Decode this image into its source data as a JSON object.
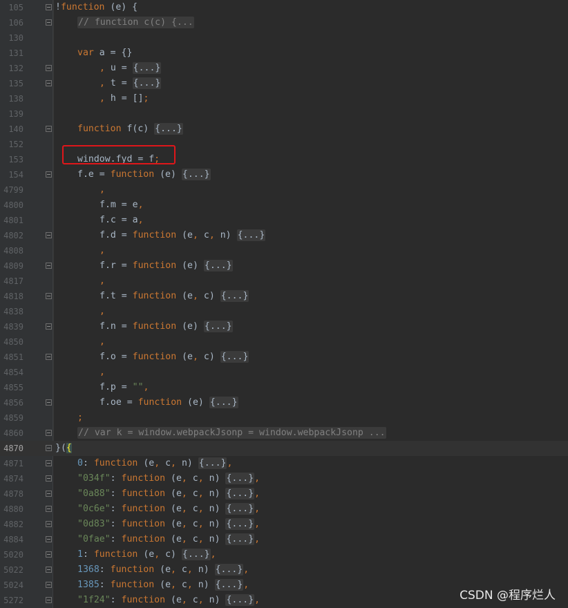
{
  "editor": {
    "current_line": "4870",
    "lines": [
      {
        "n": "105",
        "indent": 0,
        "fold": true,
        "tokens": [
          [
            "op",
            "!"
          ],
          [
            "kw",
            "function"
          ],
          [
            "txt",
            " (e) {"
          ]
        ]
      },
      {
        "n": "106",
        "indent": 1,
        "fold": true,
        "tokens": [
          [
            "fcmt",
            "// function c(c) {..."
          ]
        ]
      },
      {
        "n": "130",
        "indent": 0,
        "fold": false,
        "tokens": []
      },
      {
        "n": "131",
        "indent": 1,
        "fold": false,
        "tokens": [
          [
            "kw",
            "var"
          ],
          [
            "txt",
            " a = {}"
          ]
        ]
      },
      {
        "n": "132",
        "indent": 2,
        "fold": true,
        "tokens": [
          [
            "kw",
            ", "
          ],
          [
            "txt",
            "u = "
          ],
          [
            "fold",
            "{...}"
          ]
        ]
      },
      {
        "n": "135",
        "indent": 2,
        "fold": true,
        "tokens": [
          [
            "kw",
            ", "
          ],
          [
            "txt",
            "t = "
          ],
          [
            "fold",
            "{...}"
          ]
        ]
      },
      {
        "n": "138",
        "indent": 2,
        "fold": false,
        "tokens": [
          [
            "kw",
            ", "
          ],
          [
            "txt",
            "h = []"
          ],
          [
            "kw",
            ";"
          ]
        ]
      },
      {
        "n": "139",
        "indent": 0,
        "fold": false,
        "tokens": []
      },
      {
        "n": "140",
        "indent": 1,
        "fold": true,
        "tokens": [
          [
            "kw",
            "function"
          ],
          [
            "txt",
            " f(c) "
          ],
          [
            "fold",
            "{...}"
          ]
        ]
      },
      {
        "n": "152",
        "indent": 0,
        "fold": false,
        "tokens": []
      },
      {
        "n": "153",
        "indent": 1,
        "fold": false,
        "tokens": [
          [
            "txt",
            "window.fyd = f"
          ],
          [
            "kw",
            ";"
          ]
        ]
      },
      {
        "n": "154",
        "indent": 1,
        "fold": true,
        "tokens": [
          [
            "txt",
            "f.e = "
          ],
          [
            "kw",
            "function"
          ],
          [
            "txt",
            " (e) "
          ],
          [
            "fold",
            "{...}"
          ]
        ]
      },
      {
        "n": "4799",
        "indent": 2,
        "fold": false,
        "tokens": [
          [
            "kw",
            ","
          ]
        ]
      },
      {
        "n": "4800",
        "indent": 2,
        "fold": false,
        "tokens": [
          [
            "txt",
            "f.m = e"
          ],
          [
            "kw",
            ","
          ]
        ]
      },
      {
        "n": "4801",
        "indent": 2,
        "fold": false,
        "tokens": [
          [
            "txt",
            "f.c = a"
          ],
          [
            "kw",
            ","
          ]
        ]
      },
      {
        "n": "4802",
        "indent": 2,
        "fold": true,
        "tokens": [
          [
            "txt",
            "f.d = "
          ],
          [
            "kw",
            "function"
          ],
          [
            "txt",
            " (e"
          ],
          [
            "kw",
            ","
          ],
          [
            "txt",
            " c"
          ],
          [
            "kw",
            ","
          ],
          [
            "txt",
            " n) "
          ],
          [
            "fold",
            "{...}"
          ]
        ]
      },
      {
        "n": "4808",
        "indent": 2,
        "fold": false,
        "tokens": [
          [
            "kw",
            ","
          ]
        ]
      },
      {
        "n": "4809",
        "indent": 2,
        "fold": true,
        "tokens": [
          [
            "txt",
            "f.r = "
          ],
          [
            "kw",
            "function"
          ],
          [
            "txt",
            " (e) "
          ],
          [
            "fold",
            "{...}"
          ]
        ]
      },
      {
        "n": "4817",
        "indent": 2,
        "fold": false,
        "tokens": [
          [
            "kw",
            ","
          ]
        ]
      },
      {
        "n": "4818",
        "indent": 2,
        "fold": true,
        "tokens": [
          [
            "txt",
            "f.t = "
          ],
          [
            "kw",
            "function"
          ],
          [
            "txt",
            " (e"
          ],
          [
            "kw",
            ","
          ],
          [
            "txt",
            " c) "
          ],
          [
            "fold",
            "{...}"
          ]
        ]
      },
      {
        "n": "4838",
        "indent": 2,
        "fold": false,
        "tokens": [
          [
            "kw",
            ","
          ]
        ]
      },
      {
        "n": "4839",
        "indent": 2,
        "fold": true,
        "tokens": [
          [
            "txt",
            "f.n = "
          ],
          [
            "kw",
            "function"
          ],
          [
            "txt",
            " (e) "
          ],
          [
            "fold",
            "{...}"
          ]
        ]
      },
      {
        "n": "4850",
        "indent": 2,
        "fold": false,
        "tokens": [
          [
            "kw",
            ","
          ]
        ]
      },
      {
        "n": "4851",
        "indent": 2,
        "fold": true,
        "tokens": [
          [
            "txt",
            "f.o = "
          ],
          [
            "kw",
            "function"
          ],
          [
            "txt",
            " (e"
          ],
          [
            "kw",
            ","
          ],
          [
            "txt",
            " c) "
          ],
          [
            "fold",
            "{...}"
          ]
        ]
      },
      {
        "n": "4854",
        "indent": 2,
        "fold": false,
        "tokens": [
          [
            "kw",
            ","
          ]
        ]
      },
      {
        "n": "4855",
        "indent": 2,
        "fold": false,
        "tokens": [
          [
            "txt",
            "f.p = "
          ],
          [
            "str",
            "\"\""
          ],
          [
            "kw",
            ","
          ]
        ]
      },
      {
        "n": "4856",
        "indent": 2,
        "fold": true,
        "tokens": [
          [
            "txt",
            "f.oe = "
          ],
          [
            "kw",
            "function"
          ],
          [
            "txt",
            " (e) "
          ],
          [
            "fold",
            "{...}"
          ]
        ]
      },
      {
        "n": "4859",
        "indent": 1,
        "fold": false,
        "tokens": [
          [
            "kw",
            ";"
          ]
        ]
      },
      {
        "n": "4860",
        "indent": 1,
        "fold": true,
        "tokens": [
          [
            "fcmt",
            "// var k = window.webpackJsonp = window.webpackJsonp ..."
          ]
        ]
      },
      {
        "n": "4870",
        "indent": 0,
        "fold": true,
        "tokens": [
          [
            "txt",
            "}("
          ],
          [
            "hl",
            "{"
          ]
        ]
      },
      {
        "n": "4871",
        "indent": 1,
        "fold": true,
        "tokens": [
          [
            "num",
            "0"
          ],
          [
            "txt",
            ": "
          ],
          [
            "kw",
            "function"
          ],
          [
            "txt",
            " (e"
          ],
          [
            "kw",
            ","
          ],
          [
            "txt",
            " c"
          ],
          [
            "kw",
            ","
          ],
          [
            "txt",
            " n) "
          ],
          [
            "fold",
            "{...}"
          ],
          [
            "kw",
            ","
          ]
        ]
      },
      {
        "n": "4874",
        "indent": 1,
        "fold": true,
        "tokens": [
          [
            "str",
            "\"034f\""
          ],
          [
            "txt",
            ": "
          ],
          [
            "kw",
            "function"
          ],
          [
            "txt",
            " (e"
          ],
          [
            "kw",
            ","
          ],
          [
            "txt",
            " c"
          ],
          [
            "kw",
            ","
          ],
          [
            "txt",
            " n) "
          ],
          [
            "fold",
            "{...}"
          ],
          [
            "kw",
            ","
          ]
        ]
      },
      {
        "n": "4878",
        "indent": 1,
        "fold": true,
        "tokens": [
          [
            "str",
            "\"0a88\""
          ],
          [
            "txt",
            ": "
          ],
          [
            "kw",
            "function"
          ],
          [
            "txt",
            " (e"
          ],
          [
            "kw",
            ","
          ],
          [
            "txt",
            " c"
          ],
          [
            "kw",
            ","
          ],
          [
            "txt",
            " n) "
          ],
          [
            "fold",
            "{...}"
          ],
          [
            "kw",
            ","
          ]
        ]
      },
      {
        "n": "4880",
        "indent": 1,
        "fold": true,
        "tokens": [
          [
            "str",
            "\"0c6e\""
          ],
          [
            "txt",
            ": "
          ],
          [
            "kw",
            "function"
          ],
          [
            "txt",
            " (e"
          ],
          [
            "kw",
            ","
          ],
          [
            "txt",
            " c"
          ],
          [
            "kw",
            ","
          ],
          [
            "txt",
            " n) "
          ],
          [
            "fold",
            "{...}"
          ],
          [
            "kw",
            ","
          ]
        ]
      },
      {
        "n": "4882",
        "indent": 1,
        "fold": true,
        "tokens": [
          [
            "str",
            "\"0d83\""
          ],
          [
            "txt",
            ": "
          ],
          [
            "kw",
            "function"
          ],
          [
            "txt",
            " (e"
          ],
          [
            "kw",
            ","
          ],
          [
            "txt",
            " c"
          ],
          [
            "kw",
            ","
          ],
          [
            "txt",
            " n) "
          ],
          [
            "fold",
            "{...}"
          ],
          [
            "kw",
            ","
          ]
        ]
      },
      {
        "n": "4884",
        "indent": 1,
        "fold": true,
        "tokens": [
          [
            "str",
            "\"0fae\""
          ],
          [
            "txt",
            ": "
          ],
          [
            "kw",
            "function"
          ],
          [
            "txt",
            " (e"
          ],
          [
            "kw",
            ","
          ],
          [
            "txt",
            " c"
          ],
          [
            "kw",
            ","
          ],
          [
            "txt",
            " n) "
          ],
          [
            "fold",
            "{...}"
          ],
          [
            "kw",
            ","
          ]
        ]
      },
      {
        "n": "5020",
        "indent": 1,
        "fold": true,
        "tokens": [
          [
            "num",
            "1"
          ],
          [
            "txt",
            ": "
          ],
          [
            "kw",
            "function"
          ],
          [
            "txt",
            " (e"
          ],
          [
            "kw",
            ","
          ],
          [
            "txt",
            " c) "
          ],
          [
            "fold",
            "{...}"
          ],
          [
            "kw",
            ","
          ]
        ]
      },
      {
        "n": "5022",
        "indent": 1,
        "fold": true,
        "tokens": [
          [
            "num",
            "1368"
          ],
          [
            "txt",
            ": "
          ],
          [
            "kw",
            "function"
          ],
          [
            "txt",
            " (e"
          ],
          [
            "kw",
            ","
          ],
          [
            "txt",
            " c"
          ],
          [
            "kw",
            ","
          ],
          [
            "txt",
            " n) "
          ],
          [
            "fold",
            "{...}"
          ],
          [
            "kw",
            ","
          ]
        ]
      },
      {
        "n": "5024",
        "indent": 1,
        "fold": true,
        "tokens": [
          [
            "num",
            "1385"
          ],
          [
            "txt",
            ": "
          ],
          [
            "kw",
            "function"
          ],
          [
            "txt",
            " (e"
          ],
          [
            "kw",
            ","
          ],
          [
            "txt",
            " c"
          ],
          [
            "kw",
            ","
          ],
          [
            "txt",
            " n) "
          ],
          [
            "fold",
            "{...}"
          ],
          [
            "kw",
            ","
          ]
        ]
      },
      {
        "n": "5272",
        "indent": 1,
        "fold": true,
        "tokens": [
          [
            "str",
            "\"1f24\""
          ],
          [
            "txt",
            ": "
          ],
          [
            "kw",
            "function"
          ],
          [
            "txt",
            " (e"
          ],
          [
            "kw",
            ","
          ],
          [
            "txt",
            " c"
          ],
          [
            "kw",
            ","
          ],
          [
            "txt",
            " n) "
          ],
          [
            "fold",
            "{...}"
          ],
          [
            "kw",
            ","
          ]
        ]
      }
    ]
  },
  "watermark": "CSDN @程序烂人",
  "colors": {
    "background": "#2b2b2b",
    "gutter": "#313335",
    "keyword": "#cc7832",
    "string": "#6a8759",
    "number": "#6897bb",
    "comment": "#808080",
    "text": "#a9b7c6",
    "annotation_box": "#e0161a"
  }
}
